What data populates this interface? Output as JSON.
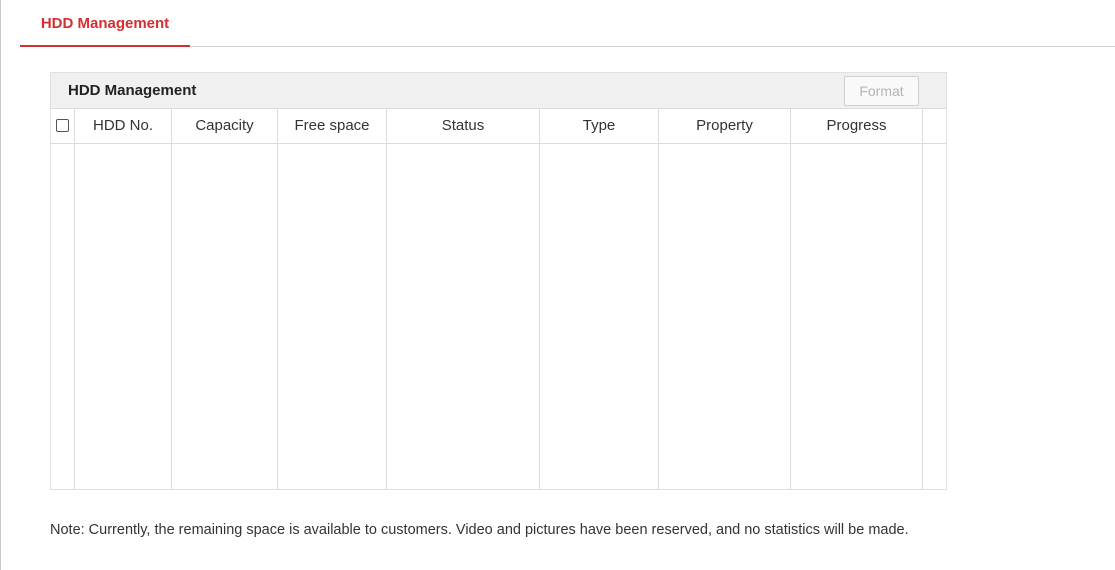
{
  "tabs": [
    {
      "label": "HDD Management",
      "active": true
    }
  ],
  "panel": {
    "title": "HDD Management",
    "format_button": {
      "label": "Format",
      "enabled": false
    }
  },
  "table": {
    "select_all_checked": false,
    "columns": [
      "HDD No.",
      "Capacity",
      "Free space",
      "Status",
      "Type",
      "Property",
      "Progress"
    ],
    "rows": []
  },
  "note": "Note: Currently, the remaining space is available to customers. Video and pictures have been reserved, and no statistics will be made.",
  "colors": {
    "accent": "#d32f2f",
    "header_bg": "#f0f0f0",
    "border": "#dcdcdc",
    "disabled_text": "#b5b5b5"
  }
}
